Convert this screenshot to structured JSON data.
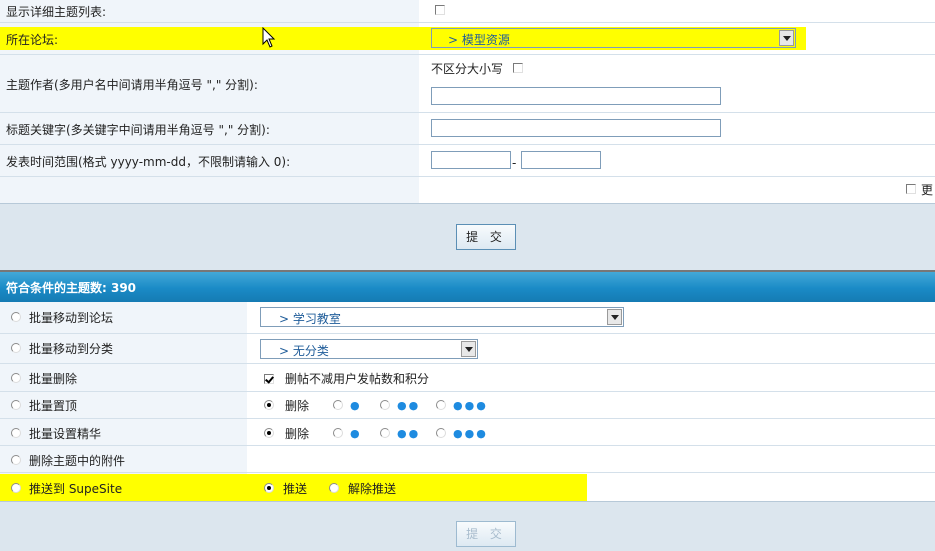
{
  "search_form": {
    "show_detail_label": "显示详细主题列表:",
    "forum_label": "所在论坛:",
    "forum_select": "> 模型资源",
    "author_label": "主题作者(多用户名中间请用半角逗号 \",\" 分割):",
    "case_insensitive_label": "不区分大小写",
    "keyword_label": "标题关键字(多关键字中间请用半角逗号 \",\" 分割):",
    "date_label": "发表时间范围(格式 yyyy-mm-dd，不限制请输入 0):",
    "date_separator": "-",
    "more_label": "更",
    "submit": "提 交"
  },
  "results": {
    "header": "符合条件的主题数: 390",
    "move_forum_label": "批量移动到论坛",
    "move_forum_select": "> 学习教室",
    "move_category_label": "批量移动到分类",
    "move_category_select": "> 无分类",
    "delete_label": "批量删除",
    "delete_option": "删帖不减用户发帖数和积分",
    "stick_label": "批量置顶",
    "stick_delete": "删除",
    "digest_label": "批量设置精华",
    "digest_delete": "删除",
    "delete_attach_label": "删除主题中的附件",
    "push_label": "推送到 SupeSite",
    "push_option": "推送",
    "unpush_option": "解除推送",
    "submit": "提 交"
  },
  "icons": [
    "mouse-cursor-icon",
    "dropdown-arrow-icon",
    "level-dot-icon"
  ],
  "colors": {
    "label_bg": "#f0f5fa",
    "band_bg": "#dce6ee",
    "header_bar": "#1a8ac6",
    "highlight": "#ffff00",
    "select_text": "#1f5c99",
    "level_dot": "#1e8be0"
  }
}
